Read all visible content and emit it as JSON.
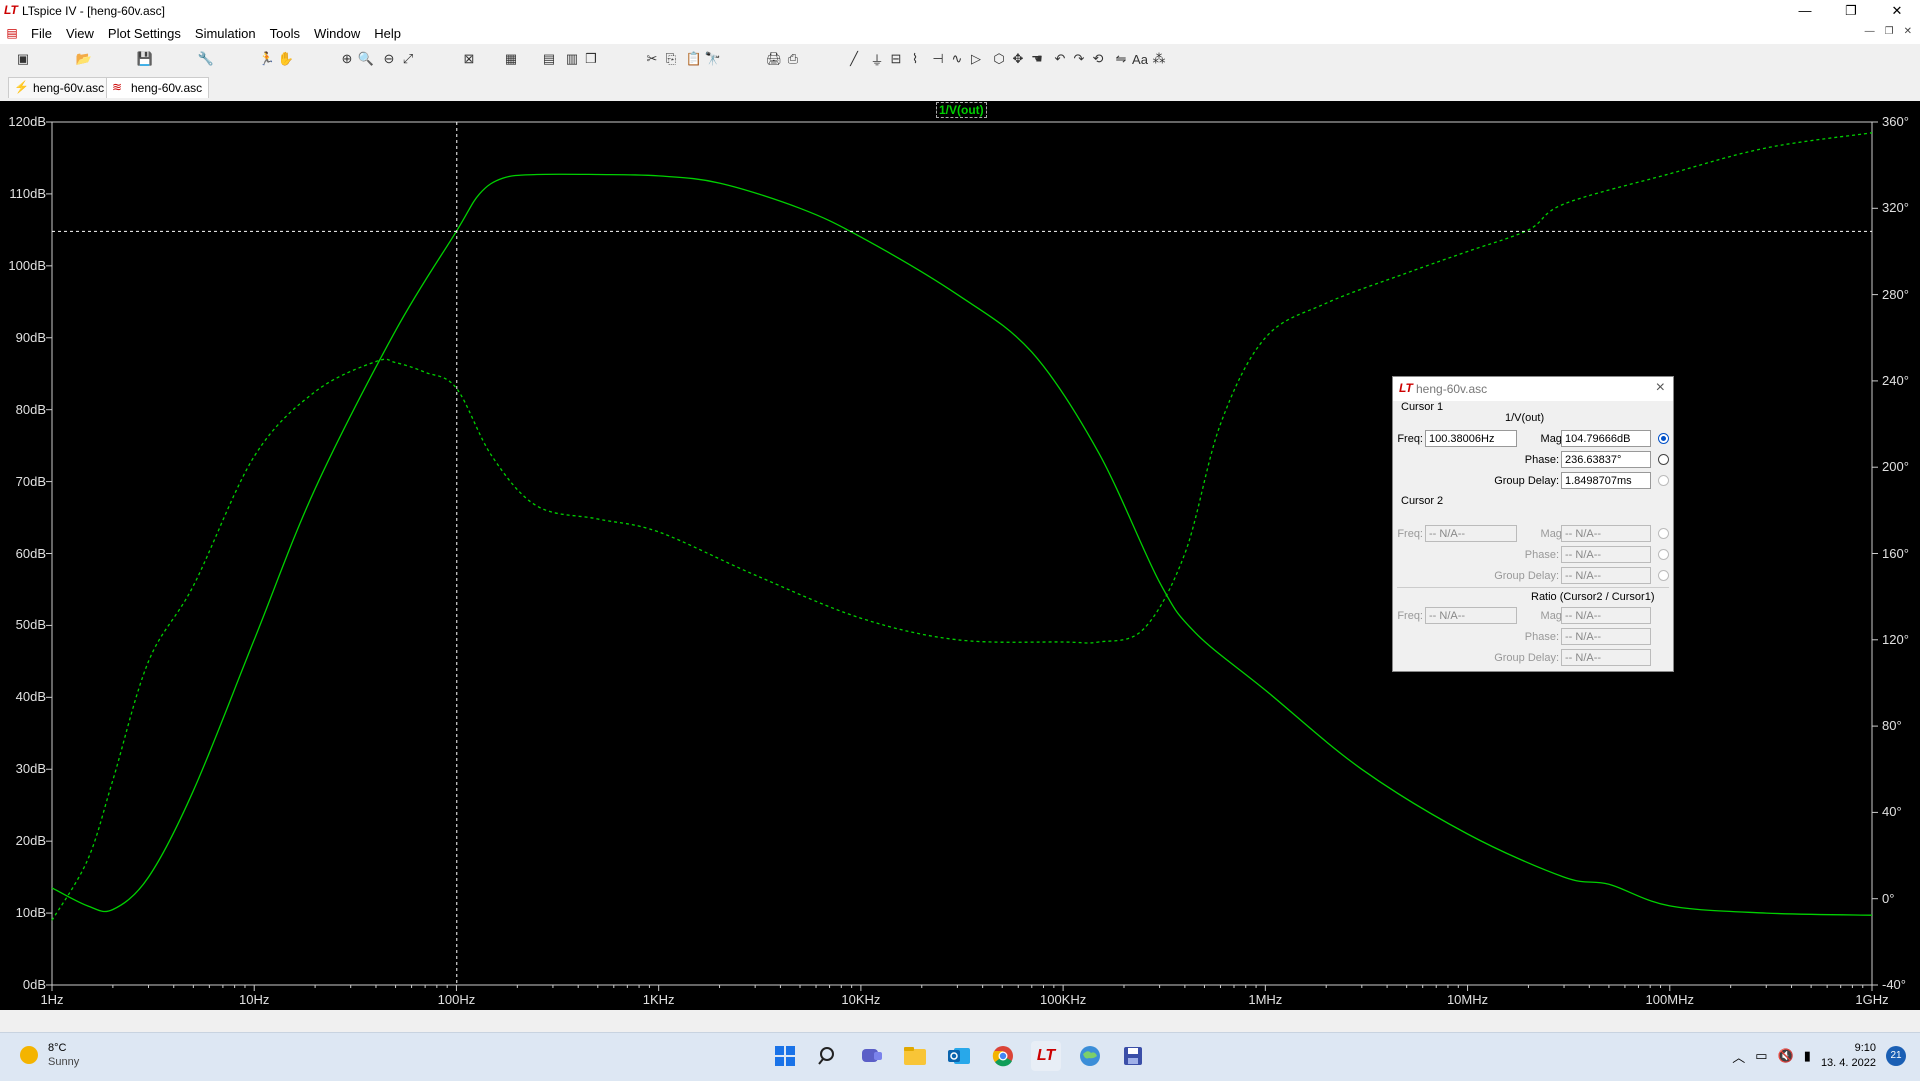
{
  "window": {
    "title": "LTspice IV - [heng-60v.asc]",
    "minimize": "—",
    "maximize": "❐",
    "close": "✕"
  },
  "menu": {
    "items": [
      "File",
      "View",
      "Plot Settings",
      "Simulation",
      "Tools",
      "Window",
      "Help"
    ],
    "mdi": [
      "—",
      "❐",
      "✕"
    ]
  },
  "toolbar": {
    "icons": [
      "new-schematic-icon",
      "open-icon",
      "save-icon",
      "control-panel-icon",
      "run-icon",
      "halt-icon",
      "zoom-in-icon",
      "zoom-area-icon",
      "zoom-out-icon",
      "zoom-fit-icon",
      "autorange-icon",
      "toggle-grid-icon",
      "tile-horizontal-icon",
      "tile-vertical-icon",
      "cascade-icon",
      "cut-icon",
      "copy-icon",
      "paste-icon",
      "find-icon",
      "print-preview-icon",
      "print-icon",
      "wire-icon",
      "ground-icon",
      "label-net-icon",
      "resistor-icon",
      "capacitor-icon",
      "inductor-icon",
      "diode-icon",
      "component-icon",
      "move-icon",
      "drag-icon",
      "undo-icon",
      "redo-icon",
      "rotate-icon",
      "mirror-icon",
      "text-icon",
      "spice-directive-icon"
    ]
  },
  "tabs": [
    {
      "label": "heng-60v.asc",
      "icon": "schematic-icon"
    },
    {
      "label": "heng-60v.asc",
      "icon": "waveform-icon"
    }
  ],
  "plot": {
    "trace_label": "1/V(out)",
    "trace_color": "#00d000",
    "background": "#000000"
  },
  "chart_data": {
    "type": "line",
    "title": "",
    "x_scale": "log",
    "xlim": [
      1,
      1000000000
    ],
    "x_ticks": [
      "1Hz",
      "10Hz",
      "100Hz",
      "1KHz",
      "10KHz",
      "100KHz",
      "1MHz",
      "10MHz",
      "100MHz",
      "1GHz"
    ],
    "ylim_left": [
      0,
      120
    ],
    "y_ticks_left": [
      "0dB",
      "10dB",
      "20dB",
      "30dB",
      "40dB",
      "50dB",
      "60dB",
      "70dB",
      "80dB",
      "90dB",
      "100dB",
      "110dB",
      "120dB"
    ],
    "ylim_right": [
      -40,
      360
    ],
    "y_ticks_right": [
      "-40°",
      "0°",
      "40°",
      "80°",
      "120°",
      "160°",
      "200°",
      "240°",
      "280°",
      "320°",
      "360°"
    ],
    "grid": false,
    "series": [
      {
        "name": "1/V(out)",
        "quantity": "magnitude",
        "style": "solid",
        "axis": "left",
        "x": [
          1,
          1.5,
          2,
          3,
          5,
          10,
          20,
          50,
          100,
          130,
          170,
          250,
          500,
          1000,
          2000,
          5000,
          10000,
          30000,
          70000,
          150000,
          300000,
          450000,
          1000000,
          3000000,
          10000000,
          30000000,
          50000000,
          100000000,
          300000000,
          1000000000
        ],
        "y": [
          13.5,
          11,
          10.5,
          15,
          27,
          48,
          69,
          91,
          104.8,
          110,
          112.2,
          112.7,
          112.7,
          112.5,
          111.5,
          108,
          104,
          96,
          88,
          74,
          56,
          49,
          41,
          30,
          21,
          15,
          14,
          11,
          10,
          9.7
        ]
      },
      {
        "name": "1/V(out)",
        "quantity": "phase",
        "style": "dashed",
        "axis": "right",
        "x": [
          1,
          1.5,
          2,
          3,
          5,
          10,
          20,
          40,
          50,
          70,
          100,
          150,
          250,
          500,
          1000,
          3000,
          10000,
          30000,
          100000,
          150000,
          250000,
          400000,
          600000,
          1000000,
          2000000,
          5000000,
          10000000,
          20000000,
          30000000,
          100000000,
          300000000,
          1000000000
        ],
        "y": [
          -10,
          18,
          55,
          110,
          145,
          205,
          235,
          249,
          248.5,
          244,
          236.6,
          205,
          182,
          176,
          170,
          150,
          130,
          120,
          119,
          119,
          125,
          160,
          220,
          260,
          276,
          290,
          300,
          310,
          322,
          336,
          348,
          355
        ]
      }
    ],
    "cursor1": {
      "x": 100.38006,
      "y_db": 104.79666
    }
  },
  "cursor_window": {
    "title": "heng-60v.asc",
    "cursor1_label": "Cursor 1",
    "trace": "1/V(out)",
    "freq_label": "Freq:",
    "freq_value": "100.38006Hz",
    "mag_label": "Mag:",
    "mag_value": "104.79666dB",
    "phase_label": "Phase:",
    "phase_value": "236.63837°",
    "gd_label": "Group Delay:",
    "gd_value": "1.8498707ms",
    "cursor2_label": "Cursor 2",
    "na": "-- N/A--",
    "ratio_label": "Ratio (Cursor2 / Cursor1)"
  },
  "taskbar": {
    "temp": "8°C",
    "condition": "Sunny",
    "apps": [
      "start-icon",
      "search-icon",
      "chat-icon",
      "file-explorer-icon",
      "outlook-icon",
      "chrome-icon",
      "ltspice-icon",
      "weather-app-icon",
      "save-app-icon"
    ],
    "time": "9:10",
    "date": "13. 4. 2022",
    "notifications": "21"
  }
}
